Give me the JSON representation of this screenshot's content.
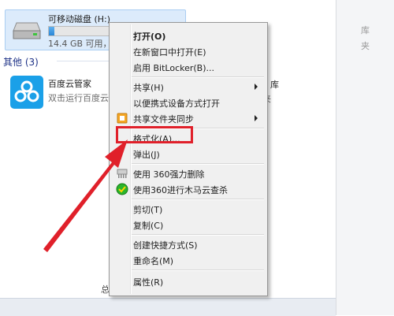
{
  "drive": {
    "name": "可移动磁盘 (H:)",
    "size_text": "14.4 GB 可用，",
    "used_fraction": 0.04
  },
  "group": {
    "label": "其他 (3)"
  },
  "app": {
    "name": "百度云管家",
    "desc": "双击运行百度云"
  },
  "background": {
    "right_top_a": "库",
    "right_top_b": "夹",
    "right_mid_a": "库",
    "right_mid_b": "夹",
    "bottom_left": "总"
  },
  "menu": {
    "items": [
      {
        "label": "打开(O)",
        "bold": true
      },
      {
        "label": "在新窗口中打开(E)"
      },
      {
        "label": "启用 BitLocker(B)..."
      },
      {
        "label": "共享(H)",
        "submenu": true
      },
      {
        "label": "以便携式设备方式打开"
      },
      {
        "label": "共享文件夹同步",
        "submenu": true
      },
      {
        "label": "格式化(A)..."
      },
      {
        "label": "弹出(J)"
      },
      {
        "label": "使用 360强力删除"
      },
      {
        "label": "使用360进行木马云查杀"
      },
      {
        "label": "剪切(T)"
      },
      {
        "label": "复制(C)"
      },
      {
        "label": "创建快捷方式(S)"
      },
      {
        "label": "重命名(M)"
      },
      {
        "label": "属性(R)"
      }
    ]
  },
  "colors": {
    "highlight": "#e0202a",
    "arrow": "#e0202a",
    "link_blue": "#1e3287",
    "selection_blue": "#dcebfb"
  }
}
